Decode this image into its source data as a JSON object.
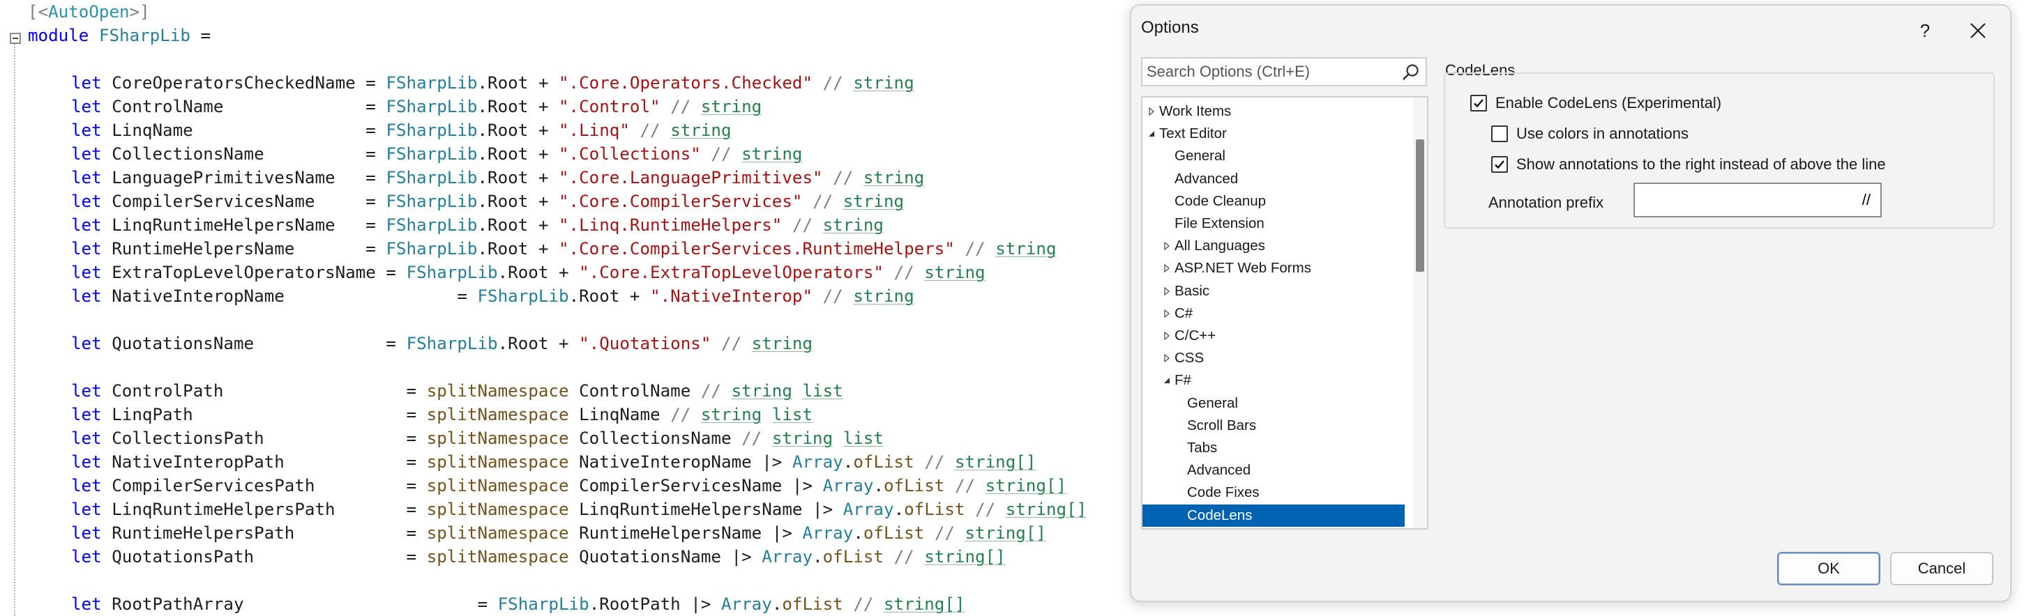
{
  "editor": {
    "lines": [
      [
        [
          "t-cmt",
          "[<"
        ],
        [
          "t-attr",
          "AutoOpen"
        ],
        [
          "t-cmt",
          ">]"
        ]
      ],
      [
        [
          "t-kw",
          "module"
        ],
        [
          "",
          "&nbsp;"
        ],
        [
          "t-type",
          "FSharpLib"
        ],
        [
          "",
          " ="
        ]
      ],
      [],
      [
        [
          "",
          ""
        ],
        [
          "t-kw",
          "let"
        ],
        [
          "",
          " CoreOperatorsCheckedName = "
        ],
        [
          "t-type",
          "FSharpLib"
        ],
        [
          "",
          ".Root + "
        ],
        [
          "t-str",
          "\".Core.Operators.Checked\""
        ],
        [
          "",
          " "
        ],
        [
          "t-cmt",
          "//"
        ],
        [
          "",
          " "
        ],
        [
          "t-hint",
          "string"
        ]
      ],
      [
        [
          "t-kw",
          "let"
        ],
        [
          "",
          " ControlName              = "
        ],
        [
          "t-type",
          "FSharpLib"
        ],
        [
          "",
          ".Root + "
        ],
        [
          "t-str",
          "\".Control\""
        ],
        [
          "",
          " "
        ],
        [
          "t-cmt",
          "//"
        ],
        [
          "",
          " "
        ],
        [
          "t-hint",
          "string"
        ]
      ],
      [
        [
          "t-kw",
          "let"
        ],
        [
          "",
          " LinqName                 = "
        ],
        [
          "t-type",
          "FSharpLib"
        ],
        [
          "",
          ".Root + "
        ],
        [
          "t-str",
          "\".Linq\""
        ],
        [
          "",
          " "
        ],
        [
          "t-cmt",
          "//"
        ],
        [
          "",
          " "
        ],
        [
          "t-hint",
          "string"
        ]
      ],
      [
        [
          "t-kw",
          "let"
        ],
        [
          "",
          " CollectionsName          = "
        ],
        [
          "t-type",
          "FSharpLib"
        ],
        [
          "",
          ".Root + "
        ],
        [
          "t-str",
          "\".Collections\""
        ],
        [
          "",
          " "
        ],
        [
          "t-cmt",
          "//"
        ],
        [
          "",
          " "
        ],
        [
          "t-hint",
          "string"
        ]
      ],
      [
        [
          "t-kw",
          "let"
        ],
        [
          "",
          " LanguagePrimitivesName   = "
        ],
        [
          "t-type",
          "FSharpLib"
        ],
        [
          "",
          ".Root + "
        ],
        [
          "t-str",
          "\".Core.LanguagePrimitives\""
        ],
        [
          "",
          " "
        ],
        [
          "t-cmt",
          "//"
        ],
        [
          "",
          " "
        ],
        [
          "t-hint",
          "string"
        ]
      ],
      [
        [
          "t-kw",
          "let"
        ],
        [
          "",
          " CompilerServicesName     = "
        ],
        [
          "t-type",
          "FSharpLib"
        ],
        [
          "",
          ".Root + "
        ],
        [
          "t-str",
          "\".Core.CompilerServices\""
        ],
        [
          "",
          " "
        ],
        [
          "t-cmt",
          "//"
        ],
        [
          "",
          " "
        ],
        [
          "t-hint",
          "string"
        ]
      ],
      [
        [
          "t-kw",
          "let"
        ],
        [
          "",
          " LinqRuntimeHelpersName   = "
        ],
        [
          "t-type",
          "FSharpLib"
        ],
        [
          "",
          ".Root + "
        ],
        [
          "t-str",
          "\".Linq.RuntimeHelpers\""
        ],
        [
          "",
          " "
        ],
        [
          "t-cmt",
          "//"
        ],
        [
          "",
          " "
        ],
        [
          "t-hint",
          "string"
        ]
      ],
      [
        [
          "t-kw",
          "let"
        ],
        [
          "",
          " RuntimeHelpersName       = "
        ],
        [
          "t-type",
          "FSharpLib"
        ],
        [
          "",
          ".Root + "
        ],
        [
          "t-str",
          "\".Core.CompilerServices.RuntimeHelpers\""
        ],
        [
          "",
          " "
        ],
        [
          "t-cmt",
          "//"
        ],
        [
          "",
          " "
        ],
        [
          "t-hint",
          "string"
        ]
      ],
      [
        [
          "t-kw",
          "let"
        ],
        [
          "",
          " ExtraTopLevelOperatorsName = "
        ],
        [
          "t-type",
          "FSharpLib"
        ],
        [
          "",
          ".Root + "
        ],
        [
          "t-str",
          "\".Core.ExtraTopLevelOperators\""
        ],
        [
          "",
          " "
        ],
        [
          "t-cmt",
          "//"
        ],
        [
          "",
          " "
        ],
        [
          "t-hint",
          "string"
        ]
      ],
      [
        [
          "t-kw",
          "let"
        ],
        [
          "",
          " NativeInteropName                 = "
        ],
        [
          "t-type",
          "FSharpLib"
        ],
        [
          "",
          ".Root + "
        ],
        [
          "t-str",
          "\".NativeInterop\""
        ],
        [
          "",
          " "
        ],
        [
          "t-cmt",
          "//"
        ],
        [
          "",
          " "
        ],
        [
          "t-hint",
          "string"
        ]
      ],
      [],
      [
        [
          "t-kw",
          "let"
        ],
        [
          "",
          " QuotationsName             = "
        ],
        [
          "t-type",
          "FSharpLib"
        ],
        [
          "",
          ".Root + "
        ],
        [
          "t-str",
          "\".Quotations\""
        ],
        [
          "",
          " "
        ],
        [
          "t-cmt",
          "//"
        ],
        [
          "",
          " "
        ],
        [
          "t-hint",
          "string"
        ]
      ],
      [],
      [
        [
          "t-kw",
          "let"
        ],
        [
          "",
          " ControlPath                  = "
        ],
        [
          "t-fn",
          "splitNamespace"
        ],
        [
          "",
          " ControlName "
        ],
        [
          "t-cmt",
          "//"
        ],
        [
          "",
          " "
        ],
        [
          "t-hint",
          "string"
        ],
        [
          "",
          " "
        ],
        [
          "t-hint",
          "list"
        ]
      ],
      [
        [
          "t-kw",
          "let"
        ],
        [
          "",
          " LinqPath                     = "
        ],
        [
          "t-fn",
          "splitNamespace"
        ],
        [
          "",
          " LinqName "
        ],
        [
          "t-cmt",
          "//"
        ],
        [
          "",
          " "
        ],
        [
          "t-hint",
          "string"
        ],
        [
          "",
          " "
        ],
        [
          "t-hint",
          "list"
        ]
      ],
      [
        [
          "t-kw",
          "let"
        ],
        [
          "",
          " CollectionsPath              = "
        ],
        [
          "t-fn",
          "splitNamespace"
        ],
        [
          "",
          " CollectionsName "
        ],
        [
          "t-cmt",
          "//"
        ],
        [
          "",
          " "
        ],
        [
          "t-hint",
          "string"
        ],
        [
          "",
          " "
        ],
        [
          "t-hint",
          "list"
        ]
      ],
      [
        [
          "t-kw",
          "let"
        ],
        [
          "",
          " NativeInteropPath            = "
        ],
        [
          "t-fn",
          "splitNamespace"
        ],
        [
          "",
          " NativeInteropName |> "
        ],
        [
          "t-type",
          "Array"
        ],
        [
          "",
          "."
        ],
        [
          "t-fn",
          "ofList"
        ],
        [
          "",
          " "
        ],
        [
          "t-cmt",
          "//"
        ],
        [
          "",
          " "
        ],
        [
          "t-hint",
          "string[]"
        ]
      ],
      [
        [
          "t-kw",
          "let"
        ],
        [
          "",
          " CompilerServicesPath         = "
        ],
        [
          "t-fn",
          "splitNamespace"
        ],
        [
          "",
          " CompilerServicesName |> "
        ],
        [
          "t-type",
          "Array"
        ],
        [
          "",
          "."
        ],
        [
          "t-fn",
          "ofList"
        ],
        [
          "",
          " "
        ],
        [
          "t-cmt",
          "//"
        ],
        [
          "",
          " "
        ],
        [
          "t-hint",
          "string[]"
        ]
      ],
      [
        [
          "t-kw",
          "let"
        ],
        [
          "",
          " LinqRuntimeHelpersPath       = "
        ],
        [
          "t-fn",
          "splitNamespace"
        ],
        [
          "",
          " LinqRuntimeHelpersName |> "
        ],
        [
          "t-type",
          "Array"
        ],
        [
          "",
          "."
        ],
        [
          "t-fn",
          "ofList"
        ],
        [
          "",
          " "
        ],
        [
          "t-cmt",
          "//"
        ],
        [
          "",
          " "
        ],
        [
          "t-hint",
          "string[]"
        ]
      ],
      [
        [
          "t-kw",
          "let"
        ],
        [
          "",
          " RuntimeHelpersPath           = "
        ],
        [
          "t-fn",
          "splitNamespace"
        ],
        [
          "",
          " RuntimeHelpersName |> "
        ],
        [
          "t-type",
          "Array"
        ],
        [
          "",
          "."
        ],
        [
          "t-fn",
          "ofList"
        ],
        [
          "",
          " "
        ],
        [
          "t-cmt",
          "//"
        ],
        [
          "",
          " "
        ],
        [
          "t-hint",
          "string[]"
        ]
      ],
      [
        [
          "t-kw",
          "let"
        ],
        [
          "",
          " QuotationsPath               = "
        ],
        [
          "t-fn",
          "splitNamespace"
        ],
        [
          "",
          " QuotationsName |> "
        ],
        [
          "t-type",
          "Array"
        ],
        [
          "",
          "."
        ],
        [
          "t-fn",
          "ofList"
        ],
        [
          "",
          " "
        ],
        [
          "t-cmt",
          "//"
        ],
        [
          "",
          " "
        ],
        [
          "t-hint",
          "string[]"
        ]
      ],
      [],
      [
        [
          "t-kw",
          "let"
        ],
        [
          "",
          " RootPathArray                       = "
        ],
        [
          "t-type",
          "FSharpLib"
        ],
        [
          "",
          ".RootPath |> "
        ],
        [
          "t-type",
          "Array"
        ],
        [
          "",
          "."
        ],
        [
          "t-fn",
          "ofList"
        ],
        [
          "",
          " "
        ],
        [
          "t-cmt",
          "//"
        ],
        [
          "",
          " "
        ],
        [
          "t-hint",
          "string[]"
        ]
      ]
    ]
  },
  "dialog": {
    "title": "Options",
    "help_label": "?",
    "search_placeholder": "Search Options (Ctrl+E)",
    "tree": [
      {
        "label": "Work Items",
        "arrow": "collapsed",
        "indent": 0
      },
      {
        "label": "Text Editor",
        "arrow": "expanded",
        "indent": 0
      },
      {
        "label": "General",
        "arrow": "none",
        "indent": 1
      },
      {
        "label": "Advanced",
        "arrow": "none",
        "indent": 1
      },
      {
        "label": "Code Cleanup",
        "arrow": "none",
        "indent": 1
      },
      {
        "label": "File Extension",
        "arrow": "none",
        "indent": 1
      },
      {
        "label": "All Languages",
        "arrow": "collapsed",
        "indent": 1
      },
      {
        "label": "ASP.NET Web Forms",
        "arrow": "collapsed",
        "indent": 1
      },
      {
        "label": "Basic",
        "arrow": "collapsed",
        "indent": 1
      },
      {
        "label": "C#",
        "arrow": "collapsed",
        "indent": 1
      },
      {
        "label": "C/C++",
        "arrow": "collapsed",
        "indent": 1
      },
      {
        "label": "CSS",
        "arrow": "collapsed",
        "indent": 1
      },
      {
        "label": "F#",
        "arrow": "expanded",
        "indent": 1
      },
      {
        "label": "General",
        "arrow": "none",
        "indent": 2
      },
      {
        "label": "Scroll Bars",
        "arrow": "none",
        "indent": 2
      },
      {
        "label": "Tabs",
        "arrow": "none",
        "indent": 2
      },
      {
        "label": "Advanced",
        "arrow": "none",
        "indent": 2
      },
      {
        "label": "Code Fixes",
        "arrow": "none",
        "indent": 2
      },
      {
        "label": "CodeLens",
        "arrow": "none",
        "indent": 2,
        "selected": true
      }
    ],
    "group_title": "CodeLens",
    "options": {
      "enable": {
        "label": "Enable CodeLens (Experimental)",
        "checked": true
      },
      "colors": {
        "label": "Use colors in annotations",
        "checked": false
      },
      "right": {
        "label": "Show annotations to the right instead of above the line",
        "checked": true
      }
    },
    "prefix_label": "Annotation prefix",
    "prefix_value": "//",
    "ok_label": "OK",
    "cancel_label": "Cancel"
  }
}
